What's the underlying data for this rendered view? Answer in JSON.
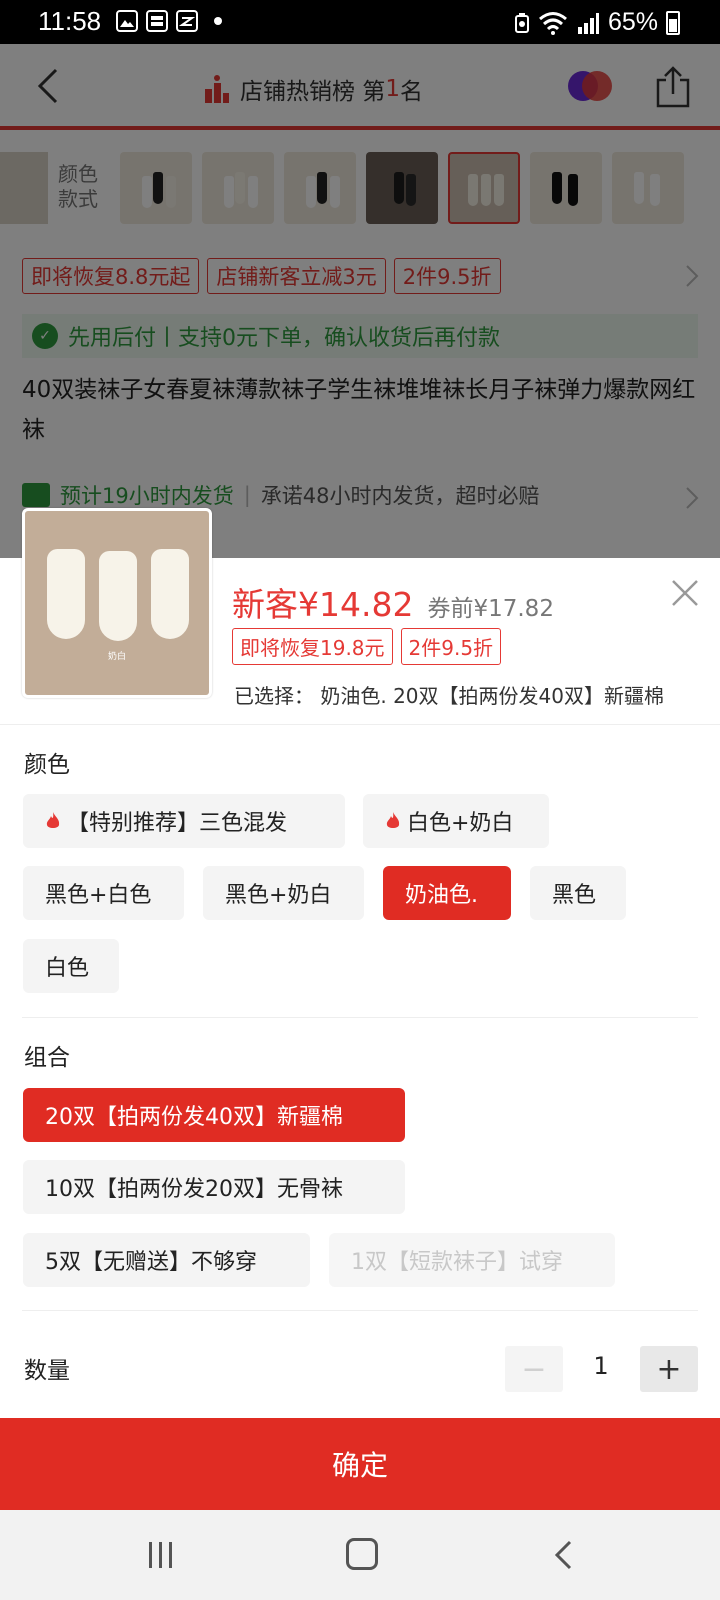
{
  "status_bar": {
    "time": "11:58",
    "battery": "65%",
    "notif_icons": [
      "gallery-icon",
      "baomoi-icon",
      "zalo-icon"
    ]
  },
  "nav": {
    "title_prefix": "店铺热销榜 第",
    "rank": "1",
    "title_suffix": "名"
  },
  "variants": {
    "label": "颜色\n款式",
    "thumbnail_count": 7
  },
  "promos": [
    "即将恢复8.8元起",
    "店铺新客立减3元",
    "2件9.5折"
  ],
  "pay_later": "先用后付丨支持0元下单，确认收货后再付款",
  "product_title": "40双装袜子女春夏袜薄款袜子学生袜堆堆袜长月子袜弹力爆款网红袜",
  "shipping": {
    "estimate": "预计19小时内发货",
    "separator": "|",
    "promise": "承诺48小时内发货，超时必赔"
  },
  "sheet": {
    "image_caption": "奶白",
    "price_new": "新客¥14.82",
    "price_old": "券前¥17.82",
    "tags": [
      "即将恢复19.8元",
      "2件9.5折"
    ],
    "selected": "已选择： 奶油色. 20双【拍两份发40双】新疆棉"
  },
  "color": {
    "title": "颜色",
    "options": [
      "【特别推荐】三色混发",
      "白色+奶白",
      "黑色+白色",
      "黑色+奶白",
      "奶油色.",
      "黑色",
      "白色"
    ],
    "hot": [
      true,
      true,
      false,
      false,
      false,
      false,
      false
    ],
    "selected_index": 4
  },
  "combo": {
    "title": "组合",
    "options": [
      "20双【拍两份发40双】新疆棉",
      "10双【拍两份发20双】无骨袜",
      "5双【无赠送】不够穿",
      "1双【短款袜子】试穿"
    ],
    "selected_index": 0,
    "disabled_index": 3
  },
  "quantity": {
    "label": "数量",
    "value": "1",
    "minus": "−",
    "plus": "+"
  },
  "confirm_label": "确定",
  "colors": {
    "accent": "#e02c23",
    "green": "#2e9b3e"
  }
}
